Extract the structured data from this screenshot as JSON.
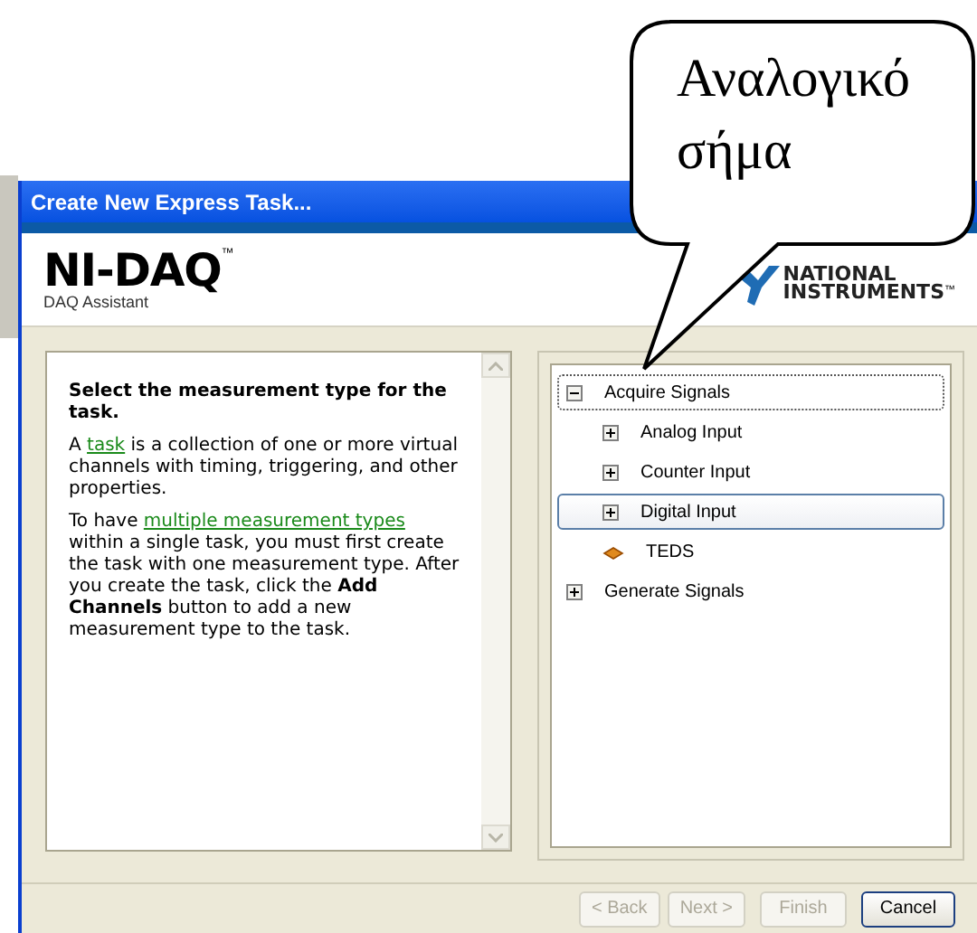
{
  "callout": {
    "text": "Αναλογικό σήμα"
  },
  "window": {
    "title": "Create New Express Task..."
  },
  "header": {
    "product": "NI-DAQ",
    "trademark": "™",
    "subtitle": "DAQ Assistant",
    "vendor_lines": [
      "NATIONAL",
      "INSTRUMENTS"
    ],
    "vendor_trademark": "™"
  },
  "help": {
    "heading": "Select the measurement type for the task.",
    "paragraphs": [
      [
        {
          "kind": "text",
          "text": "A "
        },
        {
          "kind": "link",
          "text": "task"
        },
        {
          "kind": "text",
          "text": " is a collection of one or more virtual channels with timing, triggering, and other properties."
        }
      ],
      [
        {
          "kind": "text",
          "text": "To have "
        },
        {
          "kind": "link",
          "text": "multiple measurement types"
        },
        {
          "kind": "text",
          "text": " within a single task, you must first create the task with one measurement type. After you create the task, click the **Add Channels** button to add a new measurement type to the task."
        }
      ]
    ]
  },
  "tree": [
    {
      "kind": "group",
      "label": "Acquire Signals",
      "expanded": true,
      "selected": false,
      "focused": true,
      "children": [
        {
          "kind": "group",
          "label": "Analog Input",
          "expanded": false,
          "selected": false,
          "focused": false
        },
        {
          "kind": "group",
          "label": "Counter Input",
          "expanded": false,
          "selected": false,
          "focused": false
        },
        {
          "kind": "group",
          "label": "Digital Input",
          "expanded": false,
          "selected": true,
          "focused": false
        },
        {
          "kind": "teds",
          "label": "TEDS",
          "selected": false,
          "focused": false
        }
      ]
    },
    {
      "kind": "group",
      "label": "Generate Signals",
      "expanded": false,
      "selected": false,
      "focused": false
    }
  ],
  "buttons": [
    {
      "label": "< Back",
      "disabled": true
    },
    {
      "label": "Next >",
      "disabled": true
    },
    {
      "label": "Finish",
      "disabled": true
    },
    {
      "label": "Cancel",
      "disabled": false
    }
  ]
}
